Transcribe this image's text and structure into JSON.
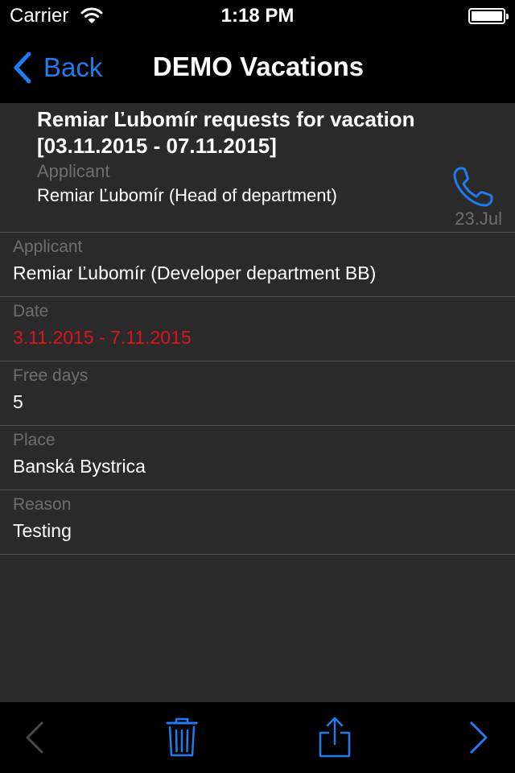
{
  "status_bar": {
    "carrier": "Carrier",
    "time": "1:18 PM"
  },
  "nav": {
    "back_label": "Back",
    "title": "DEMO Vacations"
  },
  "header": {
    "title": "Remiar Ľubomír requests for vacation [03.11.2015 - 07.11.2015]",
    "applicant_label": "Applicant",
    "applicant_value": "Remiar Ľubomír (Head of department)",
    "date": "23.Jul"
  },
  "fields": [
    {
      "label": "Applicant",
      "value": "Remiar Ľubomír (Developer department BB)"
    },
    {
      "label": "Date",
      "value": "3.11.2015 - 7.11.2015"
    },
    {
      "label": "Free days",
      "value": "5"
    },
    {
      "label": "Place",
      "value": "Banská Bystrica"
    },
    {
      "label": "Reason",
      "value": "Testing"
    }
  ],
  "icons": {
    "wifi": "wifi-icon",
    "battery": "battery-icon",
    "back": "chevron-left-icon",
    "phone": "phone-icon",
    "prev": "chevron-left-icon",
    "trash": "trash-icon",
    "share": "share-icon",
    "next": "chevron-right-icon"
  },
  "colors": {
    "accent": "#1f7cf0",
    "date_value": "#d9141b",
    "label_gray": "#6e6e6e",
    "background": "#2a2a2a",
    "bars": "#000000"
  }
}
